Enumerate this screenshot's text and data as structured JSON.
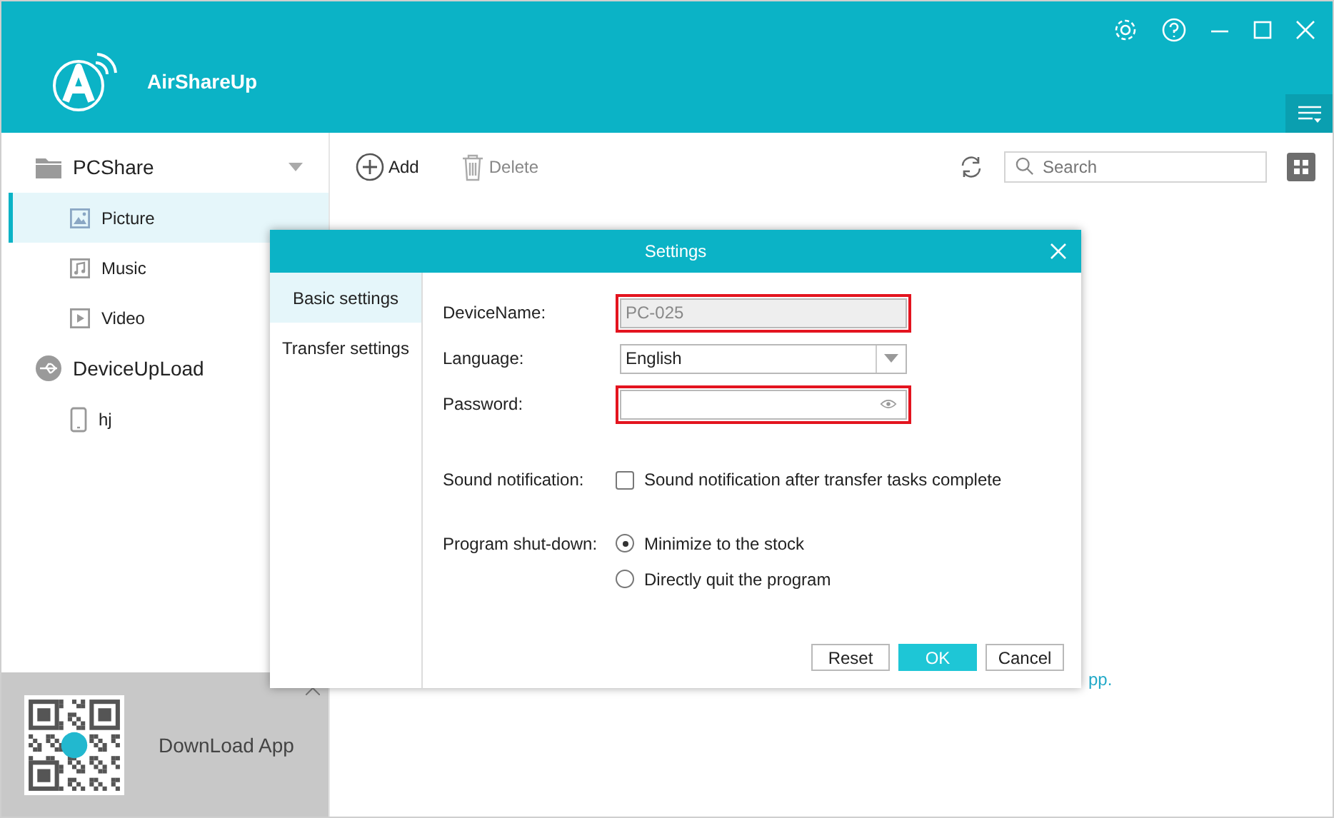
{
  "app": {
    "name": "AirShareUp"
  },
  "sidebar": {
    "groups": [
      {
        "label": "PCShare",
        "kind": "folder",
        "children": [
          {
            "label": "Picture",
            "kind": "picture",
            "selected": true
          },
          {
            "label": "Music",
            "kind": "music",
            "selected": false
          },
          {
            "label": "Video",
            "kind": "video",
            "selected": false
          }
        ]
      },
      {
        "label": "DeviceUpLoad",
        "kind": "usb",
        "children": [
          {
            "label": "hj",
            "kind": "phone",
            "selected": false
          }
        ]
      }
    ],
    "download": {
      "label": "DownLoad App"
    }
  },
  "toolbar": {
    "add": "Add",
    "delete": "Delete",
    "search": {
      "placeholder": "Search"
    }
  },
  "background_hint": "pp.",
  "dialog": {
    "title": "Settings",
    "tabs": [
      {
        "label": "Basic settings",
        "selected": true
      },
      {
        "label": "Transfer settings",
        "selected": false
      }
    ],
    "fields": [
      {
        "kind": "text",
        "label": "DeviceName:",
        "value": "PC-025",
        "disabled": true,
        "highlighted": true
      },
      {
        "kind": "select",
        "label": "Language:",
        "value": "English",
        "disabled": false,
        "highlighted": false
      },
      {
        "kind": "password",
        "label": "Password:",
        "disabled": false,
        "highlighted": true
      }
    ],
    "sound": {
      "label": "Sound notification:",
      "option": "Sound notification after transfer tasks complete",
      "checked": false
    },
    "shutdown": {
      "label": "Program shut-down:",
      "options": [
        {
          "label": "Minimize to the stock",
          "selected": true
        },
        {
          "label": "Directly quit the program",
          "selected": false
        }
      ]
    },
    "buttons": [
      {
        "label": "Reset",
        "primary": false
      },
      {
        "label": "OK",
        "primary": true
      },
      {
        "label": "Cancel",
        "primary": false
      }
    ]
  }
}
